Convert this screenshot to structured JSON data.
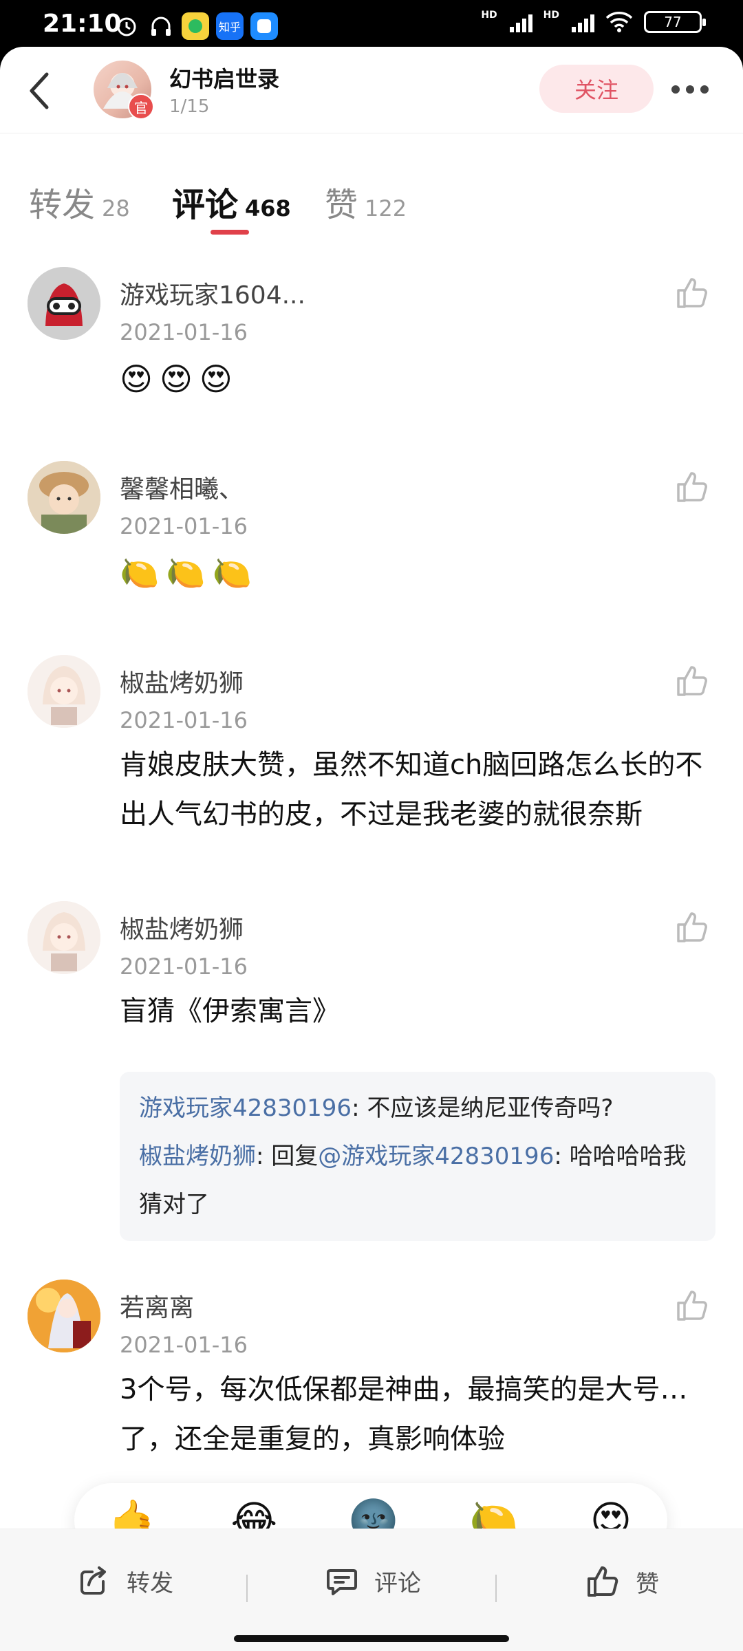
{
  "status_bar": {
    "time": "21:10",
    "icons": [
      "alarm-icon",
      "headphones-icon",
      "app-icon-yellow",
      "zhihu-icon",
      "app-icon-blue"
    ],
    "zhihu_label": "知乎",
    "battery": "77",
    "hd_label": "HD"
  },
  "header": {
    "title": "幻书启世录",
    "subtitle": "1/15",
    "official_badge": "官",
    "follow_label": "关注"
  },
  "tabs": [
    {
      "label": "转发",
      "count": "28"
    },
    {
      "label": "评论",
      "count": "468"
    },
    {
      "label": "赞",
      "count": "122"
    }
  ],
  "comments": [
    {
      "name": "游戏玩家1604...",
      "date": "2021-01-16",
      "text": "😍😍😍"
    },
    {
      "name": "馨馨相曦、",
      "date": "2021-01-16",
      "text": "🍋🍋🍋"
    },
    {
      "name": "椒盐烤奶狮",
      "date": "2021-01-16",
      "text": "肯娘皮肤大赞，虽然不知道ch脑回路怎么长的不出人气幻书的皮，不过是我老婆的就很奈斯"
    },
    {
      "name": "椒盐烤奶狮",
      "date": "2021-01-16",
      "text": "盲猜《伊索寓言》",
      "replies": [
        {
          "user": "游戏玩家42830196",
          "sep": ": ",
          "text": "不应该是纳尼亚传奇吗?"
        },
        {
          "user": "椒盐烤奶狮",
          "sep": ": 回复",
          "mention": "@游戏玩家42830196",
          "sep2": ": ",
          "text": "哈哈哈哈我猜对了"
        }
      ]
    },
    {
      "name": "若离离",
      "date": "2021-01-16",
      "text": "3个号，每次低保都是神曲，最搞笑的是大号…了，还全是重复的，真影响体验"
    }
  ],
  "reactions": [
    "🤙",
    "😂",
    "🌚",
    "🍋",
    "😍"
  ],
  "bottom_bar": {
    "repost": "转发",
    "comment": "评论",
    "like": "赞"
  }
}
